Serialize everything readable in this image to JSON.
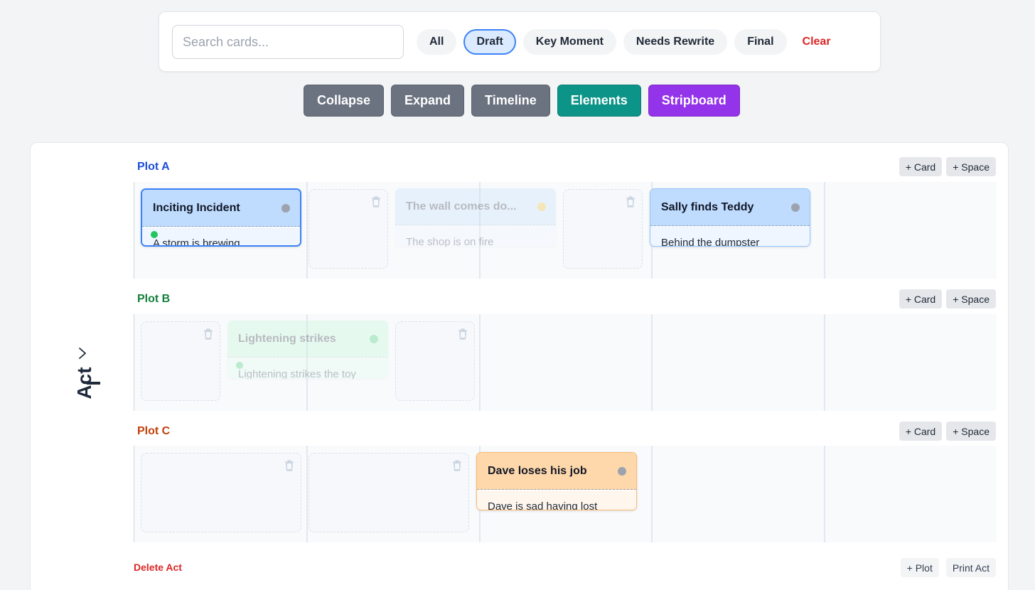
{
  "search": {
    "placeholder": "Search cards..."
  },
  "filters": {
    "chips": [
      "All",
      "Draft",
      "Key Moment",
      "Needs Rewrite",
      "Final"
    ],
    "active": "Draft",
    "clear_label": "Clear"
  },
  "toolbar": {
    "collapse": "Collapse",
    "expand": "Expand",
    "timeline": "Timeline",
    "elements": "Elements",
    "stripboard": "Stripboard",
    "colors": {
      "gray": "#6b7280",
      "teal": "#0d9488",
      "purple": "#9333ea"
    }
  },
  "act": {
    "label": "Act",
    "number": "I",
    "delete_label": "Delete Act",
    "add_plot_label": "+ Plot",
    "print_label": "Print Act",
    "plot_buttons": {
      "card": "+ Card",
      "space": "+ Space"
    },
    "plots": [
      {
        "name": "Plot A",
        "color": "#1d4ed8",
        "cards": [
          {
            "title": "Inciting Incident",
            "text": "A storm is brewing",
            "status": "draft",
            "selected": true
          },
          {
            "title": "The wall comes do...",
            "text": "The shop is on fire",
            "status": "key-moment",
            "faded": true
          },
          {
            "title": "Sally finds Teddy",
            "text": "Behind the dumpster"
          }
        ]
      },
      {
        "name": "Plot B",
        "color": "#15803d",
        "cards": [
          {
            "title": "Lightening strikes",
            "text": "Lightening strikes the toy",
            "faded": true
          }
        ]
      },
      {
        "name": "Plot C",
        "color": "#c2410c",
        "cards": [
          {
            "title": "Dave loses his job",
            "text": "Dave is sad having lost"
          }
        ]
      }
    ]
  },
  "colors": {
    "plot_a_head": "#bfdbfe",
    "plot_a_body": "#eff6ff",
    "plot_b_head": "#bbf7d0",
    "plot_b_body": "#dcfce7",
    "plot_c_head": "#fed7aa",
    "plot_c_body": "#fff7ed",
    "danger": "#dc2626"
  }
}
